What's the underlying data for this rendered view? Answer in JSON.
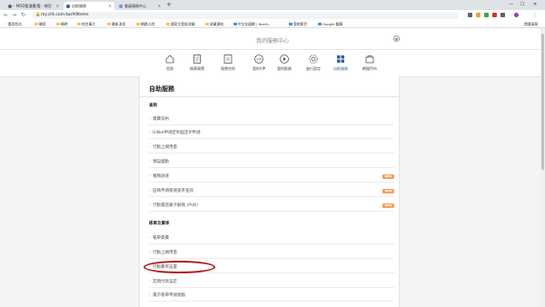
{
  "tabs": [
    {
      "label": "- MOD看漫畫/看 - 網百",
      "active": false
    },
    {
      "label": "自助服務",
      "active": true
    },
    {
      "label": "會員服務中心",
      "active": false
    }
  ],
  "address": {
    "url": "my.cht.com.tw/AllItems"
  },
  "bookmarks": [
    {
      "label": "應用程式",
      "icon": "apps-icon"
    },
    {
      "label": "輔導",
      "icon": "folder-icon"
    },
    {
      "label": "轉時",
      "icon": "folder-icon"
    },
    {
      "label": "綜合事大",
      "icon": "folder-icon"
    },
    {
      "label": "最新消息",
      "icon": "folder-icon"
    },
    {
      "label": "網路小說",
      "icon": "folder-icon"
    },
    {
      "label": "國家文藝經濟業",
      "icon": "folder-icon"
    },
    {
      "label": "收藏連結",
      "icon": "folder-icon"
    },
    {
      "label": "中文化圖網 | Nordi...",
      "icon": "site-icon"
    },
    {
      "label": "電視節目",
      "icon": "site-icon"
    },
    {
      "label": "Google 翻譯",
      "icon": "site-icon"
    }
  ],
  "bookmarks_right": "閱讀清單",
  "page_title": "我的服務中心",
  "menu": [
    {
      "label": "首頁",
      "icon": "home-icon",
      "active": false
    },
    {
      "label": "帳單資費",
      "icon": "bill-icon",
      "active": false
    },
    {
      "label": "資費合約",
      "icon": "contract-icon",
      "active": false
    },
    {
      "label": "我的VIP",
      "icon": "vip-icon",
      "active": false
    },
    {
      "label": "我的影劇",
      "icon": "play-icon",
      "active": false
    },
    {
      "label": "進行設定",
      "icon": "gear-icon",
      "active": false
    },
    {
      "label": "自助服務",
      "icon": "grid-icon",
      "active": true
    },
    {
      "label": "網路門市",
      "icon": "store-icon",
      "active": false
    }
  ],
  "card": {
    "title": "自助服務",
    "sections": [
      {
        "title": "查詢",
        "items": [
          {
            "label": "資費日約",
            "badge": ""
          },
          {
            "label": "HiNet申請定制固定IP申請",
            "badge": ""
          },
          {
            "label": "行動上網用量",
            "badge": ""
          },
          {
            "label": "預設國動",
            "badge": ""
          },
          {
            "label": "寬頻測速",
            "badge": "NEW"
          },
          {
            "label": "區碼申請帳號速率查詢",
            "badge": "NEW"
          },
          {
            "label": "行動電話鎖卡解碼 (PUK)",
            "badge": "NEW"
          }
        ]
      },
      {
        "title": "帳單及費率",
        "items": [
          {
            "label": "帳單資費",
            "badge": ""
          },
          {
            "label": "行動上網用量",
            "badge": ""
          },
          {
            "label": "行動費率設置",
            "badge": ""
          },
          {
            "label": "定期付款設定",
            "badge": ""
          },
          {
            "label": "電子帳單申請異動",
            "badge": ""
          }
        ]
      }
    ]
  },
  "colors": {
    "accent": "#2e5fa8",
    "badge": "#f0a35a",
    "highlight": "#b01c1c"
  }
}
